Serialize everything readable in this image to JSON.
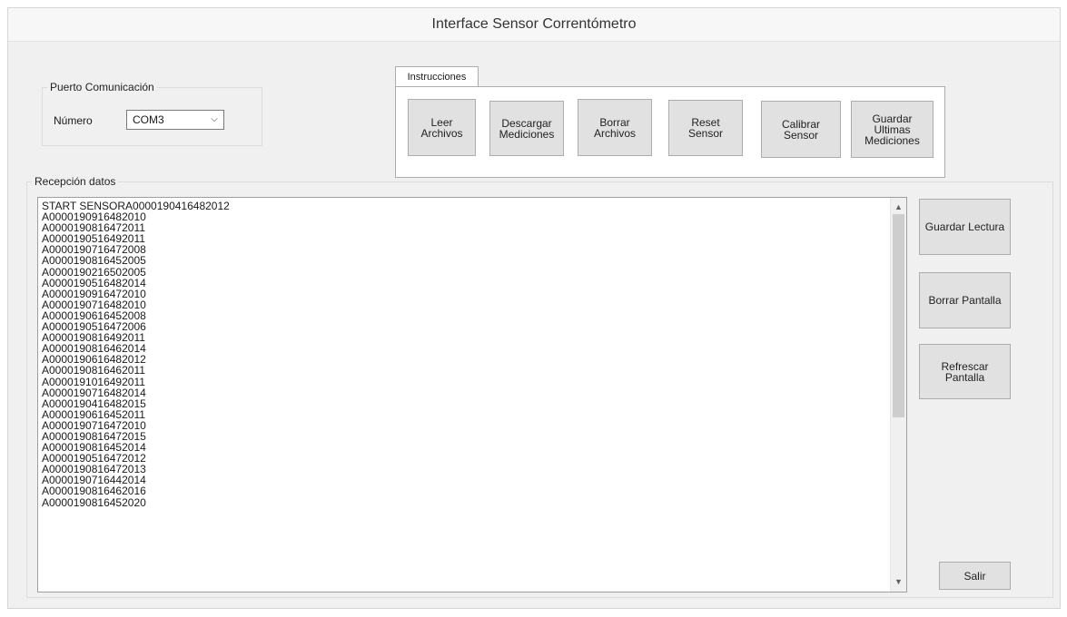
{
  "window": {
    "title": "Interface Sensor Correntómetro"
  },
  "port_group": {
    "legend": "Puerto Comunicación",
    "number_label": "Número",
    "port_value": "COM3"
  },
  "instructions": {
    "tab_label": "Instrucciones",
    "buttons": [
      "Leer\nArchivos",
      "Descargar\nMediciones",
      "Borrar\nArchivos",
      "Reset\nSensor",
      "Calibrar\nSensor",
      "Guardar\nUltimas\nMediciones"
    ]
  },
  "reception": {
    "legend": "Recepción datos",
    "lines": [
      "START SENSORA0000190416482012",
      "A0000190916482010",
      "A0000190816472011",
      "A0000190516492011",
      "A0000190716472008",
      "A0000190816452005",
      "A0000190216502005",
      "A0000190516482014",
      "A0000190916472010",
      "A0000190716482010",
      "A0000190616452008",
      "A0000190516472006",
      "A0000190816492011",
      "A0000190816462014",
      "A0000190616482012",
      "A0000190816462011",
      "A0000191016492011",
      "A0000190716482014",
      "A0000190416482015",
      "A0000190616452011",
      "A0000190716472010",
      "A0000190816472015",
      "A0000190816452014",
      "A0000190516472012",
      "A0000190816472013",
      "A0000190716442014",
      "A0000190816462016",
      "A0000190816452020"
    ]
  },
  "side_buttons": {
    "save_reading": "Guardar Lectura",
    "clear_screen": "Borrar Pantalla",
    "refresh_screen": "Refrescar Pantalla",
    "exit": "Salir"
  },
  "icons": {
    "combo_arrow": "chevron-down-icon",
    "scroll_up": "chevron-up-icon",
    "scroll_down": "chevron-down-icon"
  }
}
